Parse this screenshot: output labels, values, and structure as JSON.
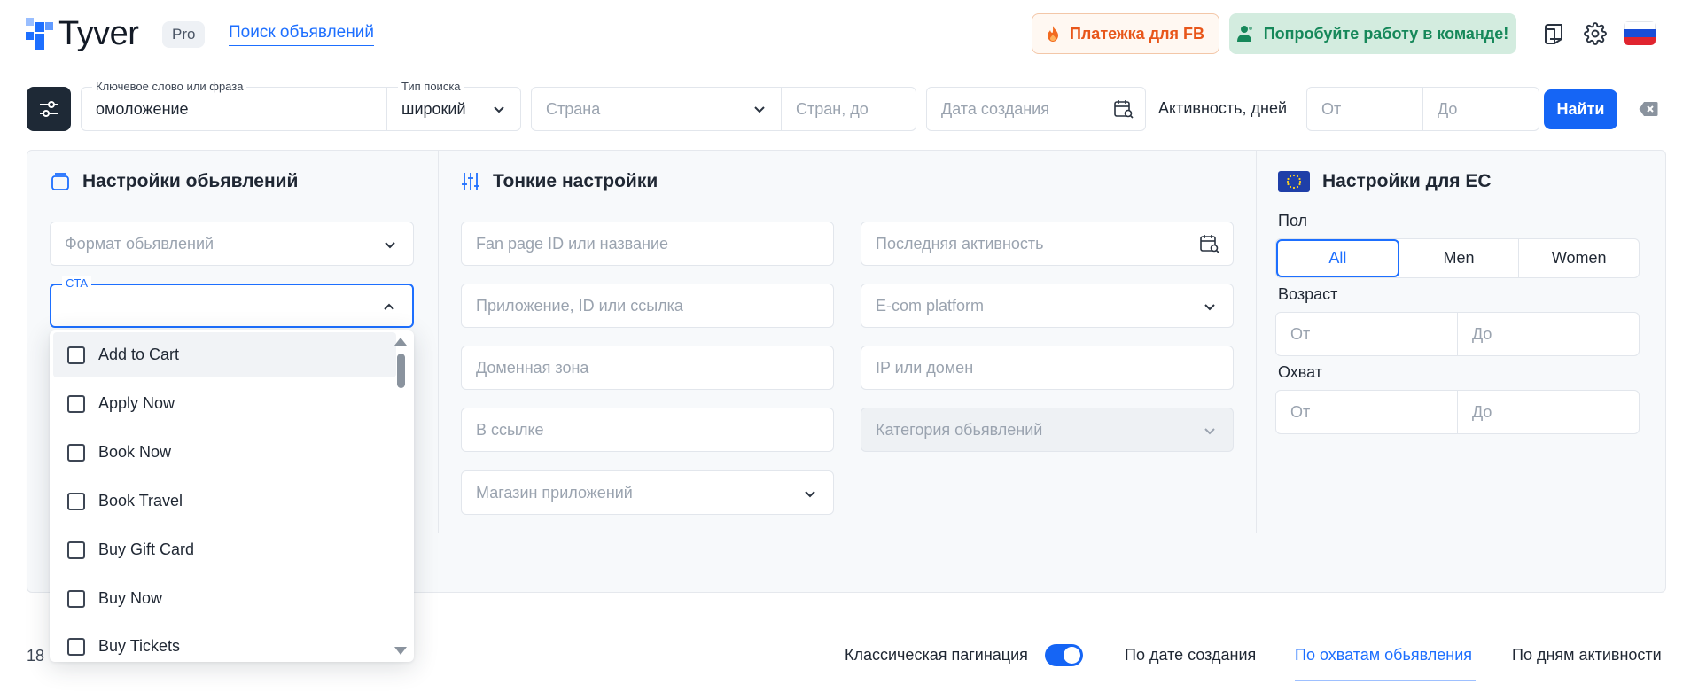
{
  "header": {
    "logo_text": "Tyver",
    "pro_badge": "Pro",
    "search_ads_link": "Поиск объявлений",
    "fb_payment_button": "Платежка для FB",
    "team_button": "Попробуйте работу в команде!",
    "language_flag": "russia-flag-icon"
  },
  "search": {
    "keyword_label": "Ключевое слово или фраза",
    "keyword_value": "омоложение",
    "search_type_label": "Тип поиска",
    "search_type_value": "широкий",
    "country_placeholder": "Страна",
    "countries_to_placeholder": "Стран, до",
    "created_date_placeholder": "Дата создания",
    "activity_label": "Активность, дней",
    "activity_from_placeholder": "От",
    "activity_to_placeholder": "До",
    "find_button": "Найти"
  },
  "ad_settings": {
    "title": "Настройки обьявлений",
    "format_placeholder": "Формат обьявлений",
    "cta_label": "CTA",
    "cta_options": [
      "Add to Cart",
      "Apply Now",
      "Book Now",
      "Book Travel",
      "Buy Gift Card",
      "Buy Now",
      "Buy Tickets"
    ]
  },
  "fine_settings": {
    "title": "Тонкие настройки",
    "fan_page_placeholder": "Fan page ID или название",
    "app_placeholder": "Приложение, ID или ссылка",
    "domain_zone_placeholder": "Доменная зона",
    "in_link_placeholder": "В ссылке",
    "app_store_placeholder": "Магазин приложений",
    "last_activity_placeholder": "Последняя активность",
    "ecom_platform_placeholder": "E-com platform",
    "ip_domain_placeholder": "IP или домен",
    "ad_category_placeholder": "Категория обьявлений"
  },
  "eu_settings": {
    "title": "Настройки для ЕС",
    "gender_label": "Пол",
    "gender_options": [
      "All",
      "Men",
      "Women"
    ],
    "gender_selected": "All",
    "age_label": "Возраст",
    "reach_label": "Охват",
    "from_placeholder": "От",
    "to_placeholder": "До"
  },
  "bottom_bar": {
    "results_count": "18",
    "classic_pagination_label": "Классическая пагинация",
    "classic_pagination_enabled": true,
    "sort_by_date": "По дате создания",
    "sort_by_reach": "По охватам обьявления",
    "sort_by_activity_days": "По дням активности",
    "active_sort": "По охватам обьявления"
  },
  "colors": {
    "accent": "#1d6fff",
    "primary_button": "#1565f5",
    "dark_button": "#1e2936",
    "fb_orange": "#e8561a",
    "team_green": "#16885a"
  }
}
